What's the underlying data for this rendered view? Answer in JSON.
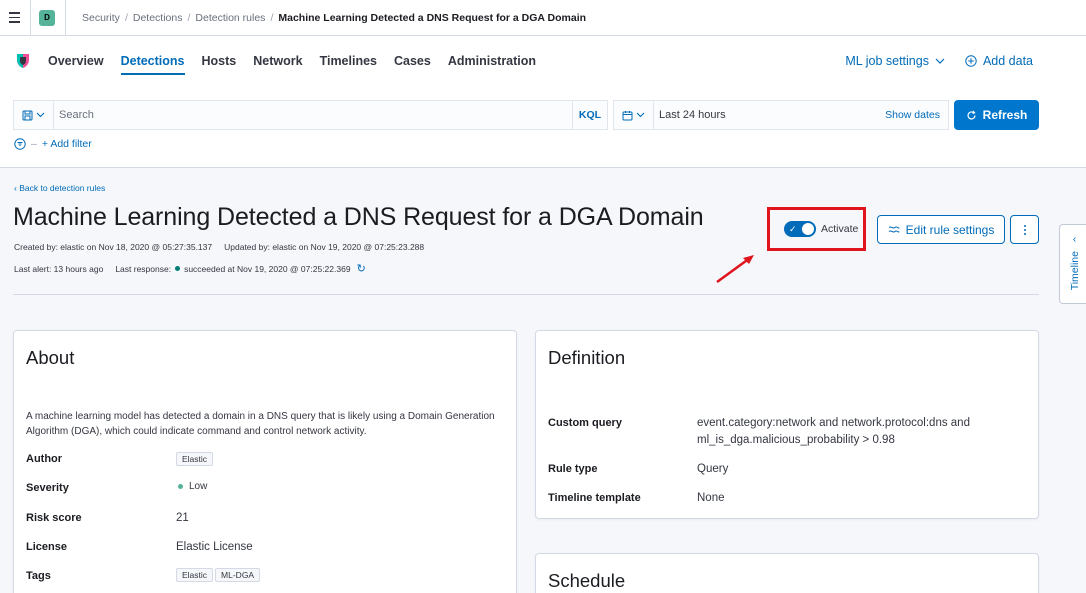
{
  "header": {
    "space_initial": "D",
    "breadcrumbs": [
      "Security",
      "Detections",
      "Detection rules",
      "Machine Learning Detected a DNS Request for a DGA Domain"
    ]
  },
  "nav": {
    "tabs": [
      "Overview",
      "Detections",
      "Hosts",
      "Network",
      "Timelines",
      "Cases",
      "Administration"
    ],
    "active_tab": "Detections",
    "ml_job_settings": "ML job settings",
    "add_data": "Add data"
  },
  "query": {
    "search_placeholder": "Search",
    "kql": "KQL",
    "date_range": "Last 24 hours",
    "show_dates": "Show dates",
    "refresh": "Refresh",
    "add_filter": "+ Add filter"
  },
  "rule": {
    "back_link": "Back to detection rules",
    "title": "Machine Learning Detected a DNS Request for a DGA Domain",
    "created_by": "Created by: elastic on Nov 18, 2020 @ 05:27:35.137",
    "updated_by": "Updated by: elastic on Nov 19, 2020 @ 07:25:23.288",
    "last_alert": "Last alert: 13 hours ago",
    "last_response_label": "Last response:",
    "last_response_value": "succeeded at Nov 19, 2020 @ 07:25:22.369",
    "activate_label": "Activate",
    "activated": true,
    "edit_button": "Edit rule settings"
  },
  "timeline_tab": "Timeline",
  "about": {
    "title": "About",
    "description": "A machine learning model has detected a domain in a DNS query that is likely using a Domain Generation Algorithm (DGA), which could indicate command and control network activity.",
    "author_label": "Author",
    "author": "Elastic",
    "severity_label": "Severity",
    "severity": "Low",
    "risk_score_label": "Risk score",
    "risk_score": "21",
    "license_label": "License",
    "license": "Elastic License",
    "tags_label": "Tags",
    "tags": [
      "Elastic",
      "ML-DGA"
    ]
  },
  "definition": {
    "title": "Definition",
    "custom_query_label": "Custom query",
    "custom_query_line1": "event.category:network and network.protocol:dns and",
    "custom_query_line2": "ml_is_dga.malicious_probability > 0.98",
    "rule_type_label": "Rule type",
    "rule_type": "Query",
    "timeline_template_label": "Timeline template",
    "timeline_template": "None"
  },
  "schedule": {
    "title": "Schedule"
  },
  "colors": {
    "accent": "#006bb8",
    "primary_button": "#0077cc",
    "annotation_red": "#e0141c",
    "success": "#017d73"
  }
}
